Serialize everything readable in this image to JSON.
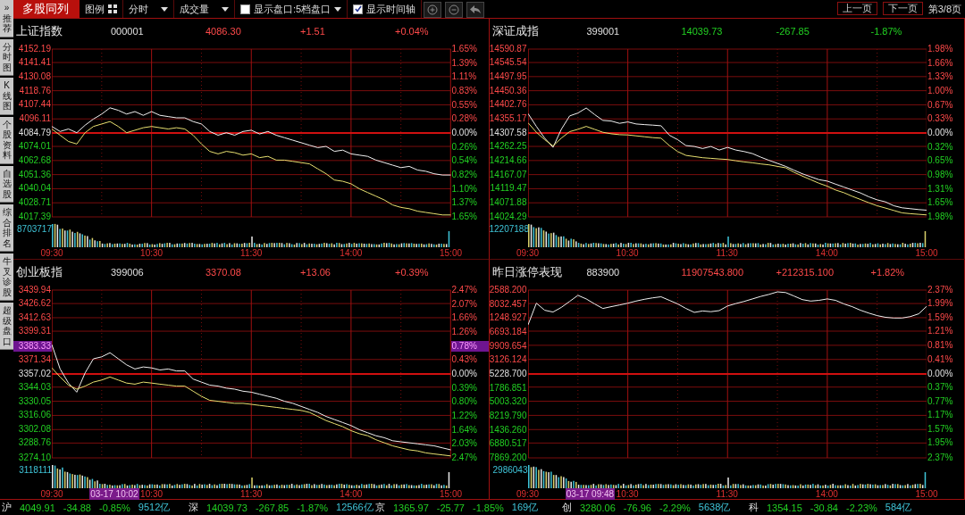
{
  "sidebar": {
    "items": [
      {
        "glyph": "»",
        "label": "推荐"
      },
      {
        "label": "分时图"
      },
      {
        "label": "K线图"
      },
      {
        "label": "个股资料"
      },
      {
        "label": "自选股"
      },
      {
        "label": "综合排名"
      },
      {
        "label": "牛叉诊股"
      },
      {
        "label": "超级盘口"
      }
    ]
  },
  "toolbar": {
    "title": "多股同列",
    "legend": "图例",
    "dropdowns": [
      {
        "label": "分时"
      },
      {
        "label": "成交量"
      }
    ],
    "options": [
      {
        "label": "显示盘口:5档盘口",
        "checked": false,
        "kind": "select"
      },
      {
        "label": "显示时间轴",
        "checked": true,
        "kind": "toggle"
      }
    ]
  },
  "pager": {
    "prev": "上一页",
    "next": "下一页",
    "page": "第3/8页"
  },
  "panels": [
    {
      "name": "上证指数",
      "code": "000001",
      "price": "4086.30",
      "change": "+1.51",
      "pct": "+0.04%",
      "kind": "up",
      "volume_label": "8703717",
      "right_axis": [
        {
          "text": "1.65%",
          "kind": "up"
        },
        {
          "text": "1.39%",
          "kind": "up"
        },
        {
          "text": "1.11%",
          "kind": "up"
        },
        {
          "text": "0.83%",
          "kind": "up"
        },
        {
          "text": "0.55%",
          "kind": "up"
        },
        {
          "text": "0.28%",
          "kind": "up"
        },
        {
          "text": "0.00%",
          "kind": "base"
        },
        {
          "text": "0.26%",
          "kind": "down"
        },
        {
          "text": "0.54%",
          "kind": "down"
        },
        {
          "text": "0.82%",
          "kind": "down"
        },
        {
          "text": "1.10%",
          "kind": "down"
        },
        {
          "text": "1.37%",
          "kind": "down"
        },
        {
          "text": "1.65%",
          "kind": "down"
        }
      ],
      "chart_data": {
        "type": "line",
        "ylim": [
          4017.39,
          4152.19
        ],
        "categories": [
          "09:30",
          null,
          null,
          null,
          null,
          null,
          null,
          null,
          null,
          null,
          null,
          null,
          "10:30",
          null,
          null,
          null,
          null,
          null,
          null,
          null,
          null,
          null,
          null,
          null,
          "11:30",
          null,
          null,
          null,
          null,
          null,
          null,
          null,
          null,
          null,
          null,
          null,
          "14:00",
          null,
          null,
          null,
          null,
          null,
          null,
          null,
          null,
          null,
          null,
          null,
          "15:00"
        ],
        "yticks": [
          {
            "value": 4152.19,
            "label": "4152.19"
          },
          {
            "value": 4141.41,
            "label": "4141.41"
          },
          {
            "value": 4130.08,
            "label": "4130.08"
          },
          {
            "value": 4118.76,
            "label": "4118.76"
          },
          {
            "value": 4107.44,
            "label": "4107.44"
          },
          {
            "value": 4096.11,
            "label": "4096.11"
          },
          {
            "value": 4084.79,
            "label": "4084.79"
          },
          {
            "value": 4074.01,
            "label": "4074.01"
          },
          {
            "value": 4062.68,
            "label": "4062.68"
          },
          {
            "value": 4051.36,
            "label": "4051.36"
          },
          {
            "value": 4040.04,
            "label": "4040.04"
          },
          {
            "value": 4028.71,
            "label": "4028.71"
          },
          {
            "value": 4017.39,
            "label": "4017.39"
          }
        ],
        "ref_lines": [
          {
            "axis": "y",
            "value": 4084.79
          }
        ],
        "grid": true,
        "series": [
          {
            "color": "#f0f0f0",
            "values": [
              4090,
              4086,
              4088,
              4085,
              4091,
              4096,
              4100,
              4105,
              4103,
              4100,
              4102,
              4099,
              4102,
              4099,
              4098,
              4097,
              4097,
              4094,
              4092,
              4086,
              4083,
              4085,
              4083,
              4086,
              4087,
              4084,
              4086,
              4083,
              4081,
              4079,
              4077,
              4075,
              4073,
              4074,
              4070,
              4071,
              4068,
              4067,
              4066,
              4063,
              4061,
              4059,
              4057,
              4058,
              4055,
              4054,
              4052,
              4051,
              4051
            ]
          },
          {
            "color": "#e8e070",
            "values": [
              4088,
              4083,
              4078,
              4076,
              4085,
              4090,
              4092,
              4094,
              4090,
              4085,
              4087,
              4089,
              4090,
              4089,
              4088,
              4089,
              4088,
              4083,
              4076,
              4070,
              4068,
              4070,
              4069,
              4067,
              4068,
              4065,
              4066,
              4063,
              4063,
              4062,
              4061,
              4060,
              4056,
              4052,
              4047,
              4046,
              4044,
              4040,
              4037,
              4034,
              4031,
              4027,
              4025,
              4024,
              4022,
              4021,
              4020,
              4019,
              4019
            ]
          }
        ]
      }
    },
    {
      "name": "深证成指",
      "code": "399001",
      "price": "14039.73",
      "change": "-267.85",
      "pct": "-1.87%",
      "kind": "down",
      "volume_label": "12207188",
      "right_axis": [
        {
          "text": "1.98%",
          "kind": "up"
        },
        {
          "text": "1.66%",
          "kind": "up"
        },
        {
          "text": "1.33%",
          "kind": "up"
        },
        {
          "text": "1.00%",
          "kind": "up"
        },
        {
          "text": "0.67%",
          "kind": "up"
        },
        {
          "text": "0.33%",
          "kind": "up"
        },
        {
          "text": "0.00%",
          "kind": "base"
        },
        {
          "text": "0.32%",
          "kind": "down"
        },
        {
          "text": "0.65%",
          "kind": "down"
        },
        {
          "text": "0.98%",
          "kind": "down"
        },
        {
          "text": "1.31%",
          "kind": "down"
        },
        {
          "text": "1.65%",
          "kind": "down"
        },
        {
          "text": "1.98%",
          "kind": "down"
        }
      ],
      "chart_data": {
        "type": "line",
        "ylim": [
          14024.29,
          14590.87
        ],
        "categories": [
          "09:30",
          null,
          null,
          null,
          null,
          null,
          null,
          null,
          null,
          null,
          null,
          null,
          "10:30",
          null,
          null,
          null,
          null,
          null,
          null,
          null,
          null,
          null,
          null,
          null,
          "11:30",
          null,
          null,
          null,
          null,
          null,
          null,
          null,
          null,
          null,
          null,
          null,
          "14:00",
          null,
          null,
          null,
          null,
          null,
          null,
          null,
          null,
          null,
          null,
          null,
          "15:00"
        ],
        "yticks": [
          {
            "value": 14590.87,
            "label": "14590.87"
          },
          {
            "value": 14545.54,
            "label": "14545.54"
          },
          {
            "value": 14497.95,
            "label": "14497.95"
          },
          {
            "value": 14450.36,
            "label": "14450.36"
          },
          {
            "value": 14402.76,
            "label": "14402.76"
          },
          {
            "value": 14355.17,
            "label": "14355.17"
          },
          {
            "value": 14307.58,
            "label": "14307.58"
          },
          {
            "value": 14262.25,
            "label": "14262.25"
          },
          {
            "value": 14214.66,
            "label": "14214.66"
          },
          {
            "value": 14167.07,
            "label": "14167.07"
          },
          {
            "value": 14119.47,
            "label": "14119.47"
          },
          {
            "value": 14071.88,
            "label": "14071.88"
          },
          {
            "value": 14024.29,
            "label": "14024.29"
          }
        ],
        "ref_lines": [
          {
            "axis": "y",
            "value": 14307.58
          }
        ],
        "grid": true,
        "series": [
          {
            "color": "#f0f0f0",
            "values": [
              14373,
              14330,
              14290,
              14259,
              14320,
              14365,
              14375,
              14392,
              14370,
              14350,
              14348,
              14340,
              14345,
              14338,
              14336,
              14334,
              14332,
              14300,
              14285,
              14265,
              14262,
              14255,
              14262,
              14250,
              14259,
              14250,
              14245,
              14238,
              14226,
              14215,
              14205,
              14195,
              14182,
              14170,
              14160,
              14150,
              14145,
              14135,
              14125,
              14115,
              14105,
              14092,
              14082,
              14075,
              14062,
              14055,
              14052,
              14049,
              14047
            ]
          },
          {
            "color": "#e8e070",
            "values": [
              14342,
              14310,
              14285,
              14264,
              14290,
              14312,
              14320,
              14330,
              14320,
              14310,
              14305,
              14302,
              14301,
              14298,
              14295,
              14292,
              14290,
              14265,
              14245,
              14232,
              14228,
              14224,
              14222,
              14220,
              14218,
              14214,
              14210,
              14207,
              14203,
              14200,
              14195,
              14190,
              14175,
              14162,
              14150,
              14138,
              14128,
              14115,
              14106,
              14094,
              14083,
              14072,
              14062,
              14054,
              14046,
              14038,
              14035,
              14033,
              14031
            ]
          }
        ]
      }
    },
    {
      "name": "创业板指",
      "code": "399006",
      "price": "3370.08",
      "change": "+13.06",
      "pct": "+0.39%",
      "kind": "up",
      "volume_label": "3118111",
      "cursor": {
        "time": "03-17 10:02",
        "value": "3383.33"
      },
      "right_axis": [
        {
          "text": "2.47%",
          "kind": "up"
        },
        {
          "text": "2.07%",
          "kind": "up"
        },
        {
          "text": "1.66%",
          "kind": "up"
        },
        {
          "text": "1.26%",
          "kind": "up"
        },
        {
          "text": "0.78%",
          "kind": "cursor"
        },
        {
          "text": "0.43%",
          "kind": "up"
        },
        {
          "text": "0.00%",
          "kind": "base"
        },
        {
          "text": "0.39%",
          "kind": "down"
        },
        {
          "text": "0.80%",
          "kind": "down"
        },
        {
          "text": "1.22%",
          "kind": "down"
        },
        {
          "text": "1.64%",
          "kind": "down"
        },
        {
          "text": "2.03%",
          "kind": "down"
        },
        {
          "text": "2.47%",
          "kind": "down"
        }
      ],
      "chart_data": {
        "type": "line",
        "ylim": [
          3274.1,
          3439.94
        ],
        "categories": [
          "09:30",
          null,
          null,
          null,
          null,
          null,
          null,
          null,
          null,
          null,
          null,
          null,
          "10:30",
          null,
          null,
          null,
          null,
          null,
          null,
          null,
          null,
          null,
          null,
          null,
          "11:30",
          null,
          null,
          null,
          null,
          null,
          null,
          null,
          null,
          null,
          null,
          null,
          "14:00",
          null,
          null,
          null,
          null,
          null,
          null,
          null,
          null,
          null,
          null,
          null,
          "15:00"
        ],
        "yticks": [
          {
            "value": 3439.94,
            "label": "3439.94"
          },
          {
            "value": 3426.62,
            "label": "3426.62"
          },
          {
            "value": 3412.63,
            "label": "3412.63"
          },
          {
            "value": 3399.31,
            "label": "3399.31"
          },
          {
            "value": 3371.34,
            "label": "3371.34"
          },
          {
            "value": 3357.02,
            "label": "3357.02"
          },
          {
            "value": 3344.03,
            "label": "3344.03"
          },
          {
            "value": 3330.05,
            "label": "3330.05"
          },
          {
            "value": 3316.06,
            "label": "3316.06"
          },
          {
            "value": 3302.08,
            "label": "3302.08"
          },
          {
            "value": 3288.76,
            "label": "3288.76"
          },
          {
            "value": 3274.1,
            "label": "3274.10"
          }
        ],
        "ref_lines": [
          {
            "axis": "y",
            "value": 3357.02
          }
        ],
        "grid": true,
        "series": [
          {
            "color": "#f0f0f0",
            "values": [
              3386,
              3362,
              3348,
              3339,
              3358,
              3372,
              3374,
              3378,
              3372,
              3366,
              3362,
              3364,
              3363,
              3361,
              3362,
              3360,
              3360,
              3352,
              3349,
              3346,
              3345,
              3343,
              3342,
              3340,
              3339,
              3337,
              3335,
              3333,
              3330,
              3328,
              3325,
              3322,
              3319,
              3315,
              3312,
              3309,
              3306,
              3302,
              3299,
              3296,
              3294,
              3291,
              3290,
              3289,
              3288,
              3287,
              3286,
              3284,
              3282
            ]
          },
          {
            "color": "#e8e070",
            "values": [
              3363,
              3354,
              3346,
              3342,
              3345,
              3349,
              3351,
              3354,
              3351,
              3348,
              3347,
              3349,
              3348,
              3347,
              3346,
              3345,
              3345,
              3340,
              3335,
              3331,
              3330,
              3329,
              3328,
              3328,
              3327,
              3326,
              3325,
              3324,
              3323,
              3322,
              3321,
              3319,
              3315,
              3311,
              3308,
              3305,
              3301,
              3298,
              3296,
              3292,
              3289,
              3286,
              3284,
              3282,
              3281,
              3279,
              3278,
              3277,
              3276
            ]
          }
        ]
      }
    },
    {
      "name": "昨日涨停表现",
      "code": "883900",
      "price": "11907543.800",
      "change": "+212315.100",
      "pct": "+1.82%",
      "kind": "up",
      "volume_label": "2986043",
      "cursor": {
        "time": "03-17 09:48"
      },
      "left_axis": [
        {
          "text": "2588.200",
          "kind": "up"
        },
        {
          "text": "8032.457",
          "kind": "up"
        },
        {
          "text": "1248.927",
          "kind": "up"
        },
        {
          "text": "6693.184",
          "kind": "up"
        },
        {
          "text": "9909.654",
          "kind": "up"
        },
        {
          "text": "3126.124",
          "kind": "up"
        },
        {
          "text": "5228.700",
          "kind": "base"
        },
        {
          "text": "1786.851",
          "kind": "down"
        },
        {
          "text": "5003.320",
          "kind": "down"
        },
        {
          "text": "8219.790",
          "kind": "down"
        },
        {
          "text": "1436.260",
          "kind": "down"
        },
        {
          "text": "6880.517",
          "kind": "down"
        },
        {
          "text": "7869.200",
          "kind": "down"
        }
      ],
      "chart_data": {
        "type": "line",
        "ylim": [
          -2.37,
          2.37
        ],
        "categories": [
          "09:30",
          null,
          null,
          null,
          null,
          null,
          null,
          null,
          null,
          null,
          null,
          null,
          "10:30",
          null,
          null,
          null,
          null,
          null,
          null,
          null,
          null,
          null,
          null,
          null,
          "11:30",
          null,
          null,
          null,
          null,
          null,
          null,
          null,
          null,
          null,
          null,
          null,
          "14:00",
          null,
          null,
          null,
          null,
          null,
          null,
          null,
          null,
          null,
          null,
          null,
          "15:00"
        ],
        "yticks": [
          {
            "value": 2.37,
            "label": "2.37%"
          },
          {
            "value": 1.99,
            "label": "1.99%"
          },
          {
            "value": 1.59,
            "label": "1.59%"
          },
          {
            "value": 1.21,
            "label": "1.21%"
          },
          {
            "value": 0.81,
            "label": "0.81%"
          },
          {
            "value": 0.41,
            "label": "0.41%"
          },
          {
            "value": 0,
            "label": "0.00%"
          },
          {
            "value": -0.37,
            "label": "0.37%"
          },
          {
            "value": -0.77,
            "label": "0.77%"
          },
          {
            "value": -1.17,
            "label": "1.17%"
          },
          {
            "value": -1.57,
            "label": "1.57%"
          },
          {
            "value": -1.95,
            "label": "1.95%"
          },
          {
            "value": -2.37,
            "label": "2.37%"
          }
        ],
        "ref_lines": [
          {
            "axis": "y",
            "value": 0
          }
        ],
        "grid": true,
        "series": [
          {
            "color": "#f0f0f0",
            "values": [
              1.39,
              2.0,
              1.8,
              1.75,
              1.88,
              2.05,
              2.22,
              2.12,
              1.98,
              1.85,
              1.9,
              1.95,
              2.0,
              2.06,
              2.11,
              2.15,
              2.18,
              2.08,
              1.98,
              1.85,
              1.74,
              1.78,
              1.76,
              1.79,
              1.92,
              1.99,
              2.05,
              2.12,
              2.19,
              2.25,
              2.32,
              2.3,
              2.2,
              2.1,
              2.06,
              2.08,
              2.12,
              2.08,
              1.98,
              1.9,
              1.8,
              1.72,
              1.65,
              1.6,
              1.58,
              1.58,
              1.62,
              1.7,
              1.92
            ]
          }
        ]
      }
    }
  ],
  "status_bar": [
    {
      "name": "沪",
      "price": "4049.91",
      "change": "-34.88",
      "pct": "-0.85%",
      "amount": "9512亿",
      "kind": "down"
    },
    {
      "name": "深",
      "price": "14039.73",
      "change": "-267.85",
      "pct": "-1.87%",
      "amount": "12566亿",
      "kind": "down"
    },
    {
      "name": "京",
      "price": "1365.97",
      "change": "-25.77",
      "pct": "-1.85%",
      "amount": "169亿",
      "kind": "down"
    },
    {
      "name": "创",
      "price": "3280.06",
      "change": "-76.96",
      "pct": "-2.29%",
      "amount": "5638亿",
      "kind": "down"
    },
    {
      "name": "科",
      "price": "1354.15",
      "change": "-30.84",
      "pct": "-2.23%",
      "amount": "584亿",
      "kind": "down"
    }
  ]
}
